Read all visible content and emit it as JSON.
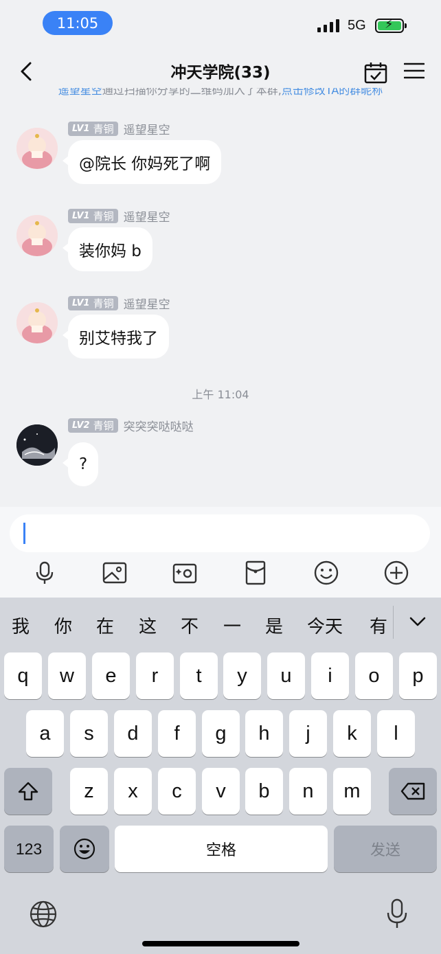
{
  "status_bar": {
    "time": "11:05",
    "network": "5G"
  },
  "header": {
    "title": "冲天学院(33)"
  },
  "system_notice": {
    "name_link": "遥望星空",
    "text": "通过扫描你分享的二维码加入了本群,",
    "action_link": "点击修改TA的群昵称"
  },
  "messages": [
    {
      "level": "LV1",
      "rank": "青铜",
      "nickname": "遥望星空",
      "text": "@院长 你妈死了啊"
    },
    {
      "level": "LV1",
      "rank": "青铜",
      "nickname": "遥望星空",
      "text": "装你妈 b"
    },
    {
      "level": "LV1",
      "rank": "青铜",
      "nickname": "遥望星空",
      "text": "别艾特我了"
    },
    {
      "level": "LV2",
      "rank": "青铜",
      "nickname": "突突突哒哒哒",
      "text": "?"
    }
  ],
  "timestamp": "上午 11:04",
  "input": {
    "value": ""
  },
  "toolbar": [
    "mic-icon",
    "image-icon",
    "camera-icon",
    "red-packet-icon",
    "emoji-icon",
    "plus-icon"
  ],
  "keyboard": {
    "suggestions": [
      "我",
      "你",
      "在",
      "这",
      "不",
      "一",
      "是",
      "今天",
      "有"
    ],
    "row1": [
      "q",
      "w",
      "e",
      "r",
      "t",
      "y",
      "u",
      "i",
      "o",
      "p"
    ],
    "row2": [
      "a",
      "s",
      "d",
      "f",
      "g",
      "h",
      "j",
      "k",
      "l"
    ],
    "row3": [
      "z",
      "x",
      "c",
      "v",
      "b",
      "n",
      "m"
    ],
    "numbers_label": "123",
    "space_label": "空格",
    "send_label": "发送"
  }
}
